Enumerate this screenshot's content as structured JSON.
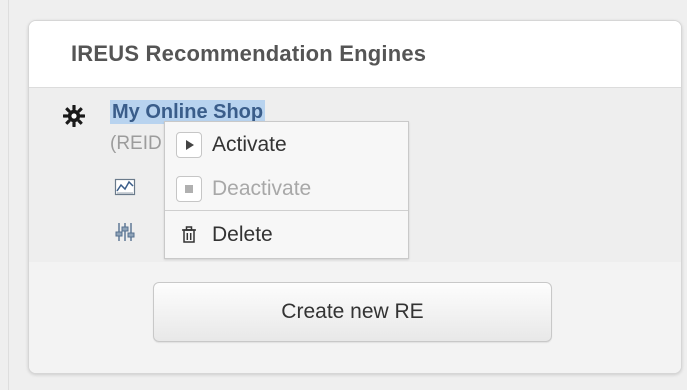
{
  "panel": {
    "title": "IREUS Recommendation Engines"
  },
  "engine": {
    "name": "My Online Shop",
    "id_text": "(REID",
    "icons": [
      "gear-icon",
      "chart-icon",
      "settings-sliders-icon"
    ]
  },
  "context_menu": {
    "items": [
      {
        "label": "Activate",
        "icon": "play-icon",
        "enabled": true
      },
      {
        "label": "Deactivate",
        "icon": "stop-icon",
        "enabled": false
      },
      {
        "label": "Delete",
        "icon": "trash-icon",
        "enabled": true
      }
    ]
  },
  "footer": {
    "create_label": "Create new RE"
  },
  "colors": {
    "selection": "#b8d3ef",
    "link": "#3a5d8a",
    "title": "#555555",
    "disabled": "#a8a8a8"
  }
}
